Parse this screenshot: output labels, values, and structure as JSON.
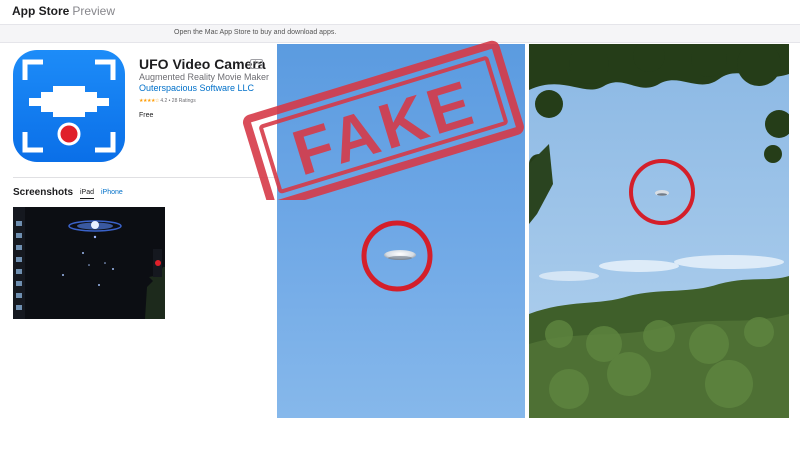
{
  "header": {
    "store_label": "App Store",
    "preview_label": "Preview"
  },
  "banner": {
    "text": "Open the Mac App Store to buy and download apps."
  },
  "app": {
    "icon_name": "ufo-camera-app-icon",
    "title": "UFO Video Camera",
    "age_rating": "4+",
    "subtitle": "Augmented Reality Movie Maker",
    "developer": "Outerspacious Software LLC",
    "rating_stars": 4.2,
    "rating_text": "4.2 • 28 Ratings",
    "price": "Free"
  },
  "screenshots": {
    "title": "Screenshots",
    "tabs": [
      "iPad",
      "iPhone"
    ],
    "selected_tab": "iPad"
  },
  "stamp": {
    "text": "FAKE",
    "color": "#d63a48"
  },
  "colors": {
    "accent_link": "#0070c9",
    "icon_blue": "#1584f5",
    "record_red": "#e0202a",
    "circle_red": "#d41f2a"
  }
}
